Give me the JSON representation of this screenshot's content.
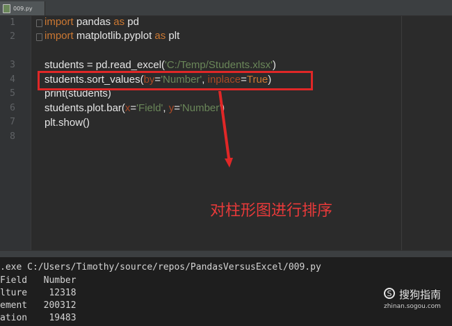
{
  "tab": {
    "filename": "009.py"
  },
  "gutter": {
    "line_numbers": [
      "1",
      "2",
      "3",
      "4",
      "5",
      "6",
      "7",
      "8"
    ]
  },
  "code": {
    "line1": {
      "kw1": "import",
      "mod": " pandas ",
      "kw2": "as",
      "alias": " pd"
    },
    "line2": {
      "kw1": "import",
      "mod": " matplotlib.pyplot ",
      "kw2": "as",
      "alias": " plt"
    },
    "line4": {
      "pre": "students = pd.read_excel(",
      "str": "'C:/Temp/Students.xlsx'",
      "post": ")"
    },
    "line5": {
      "pre": "students.sort_values(",
      "p1": "by",
      "eq1": "=",
      "s1": "'Number'",
      "comma": ", ",
      "p2": "inplace",
      "eq2": "=",
      "v2": "True",
      "post": ")"
    },
    "line6": {
      "text": "print(students)"
    },
    "line7": {
      "pre": "students.plot.bar(",
      "p1": "x",
      "eq1": "=",
      "s1": "'Field'",
      "comma": ", ",
      "p2": "y",
      "eq2": "=",
      "s2": "'Number'",
      "post": ")"
    },
    "line8": {
      "text": "plt.show()"
    }
  },
  "annotation": {
    "text": "对柱形图进行排序",
    "color": "#e83a3a"
  },
  "console": {
    "lines": [
      ".exe C:/Users/Timothy/source/repos/PandasVersusExcel/009.py",
      "Field   Number",
      "lture    12318",
      "ement   200312",
      "ation    19483"
    ]
  },
  "watermark": {
    "brand": "搜狗指南",
    "url": "zhinan.sogou.com"
  },
  "colors": {
    "keyword": "#cc7832",
    "string": "#6a8759",
    "param": "#aa4926",
    "highlight": "#e02727"
  }
}
